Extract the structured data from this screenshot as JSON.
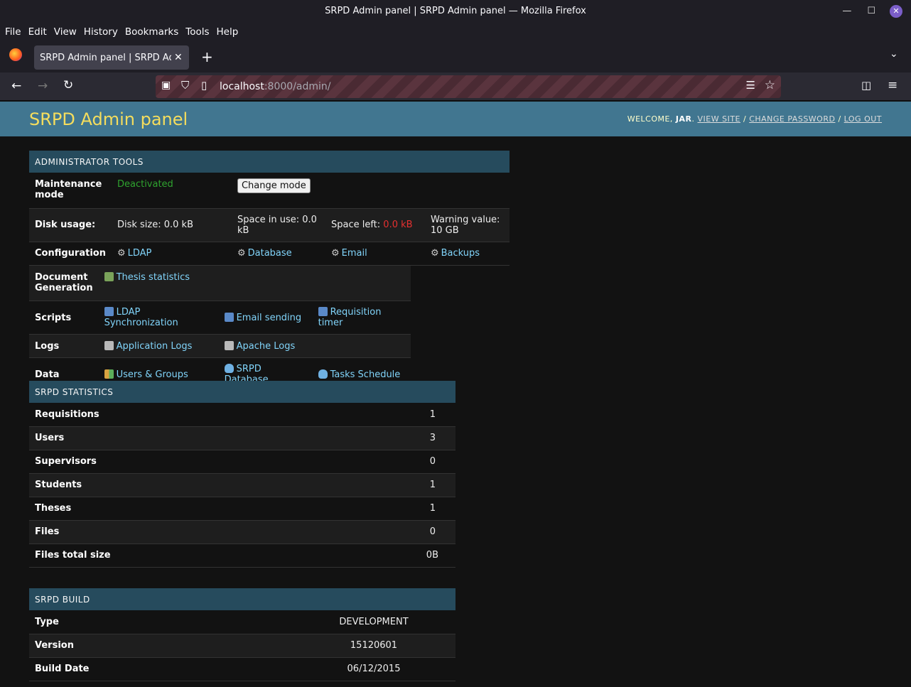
{
  "window": {
    "title": "SRPD Admin panel | SRPD Admin panel — Mozilla Firefox"
  },
  "menu": [
    "File",
    "Edit",
    "View",
    "History",
    "Bookmarks",
    "Tools",
    "Help"
  ],
  "tab": {
    "title": "SRPD Admin panel | SRPD Admi"
  },
  "address": {
    "host": "localhost",
    "rest": ":8000/admin/"
  },
  "header": {
    "brand": "SRPD Admin panel",
    "welcome": "Welcome,",
    "user": "JAR",
    "view_site": "View site",
    "change_password": "Change password",
    "log_out": "Log out"
  },
  "admin_tools": {
    "caption": "Administrator Tools",
    "maintenance_label": "Maintenance mode",
    "maintenance_status": "Deactivated",
    "change_mode": "Change mode",
    "disk_label": "Disk usage:",
    "disk_size": "Disk size: 0.0 kB",
    "space_in_use": "Space in use: 0.0 kB",
    "space_left_label": "Space left:",
    "space_left_value": "0.0 kB",
    "warning_value": "Warning value: 10 GB",
    "config_label": "Configuration",
    "config_ldap": "LDAP",
    "config_database": "Database",
    "config_email": "Email",
    "config_backups": "Backups",
    "docgen_label": "Document Generation",
    "thesis_stats": "Thesis statistics",
    "scripts_label": "Scripts",
    "ldap_sync": "LDAP Synchronization",
    "email_sending": "Email sending",
    "requisition_timer": "Requisition timer",
    "logs_label": "Logs",
    "app_logs": "Application Logs",
    "apache_logs": "Apache Logs",
    "data_label": "Data",
    "users_groups": "Users & Groups",
    "srpd_database": "SRPD Database",
    "tasks_schedule": "Tasks Schedule"
  },
  "statistics": {
    "caption": "SRPD Statistics",
    "rows": [
      {
        "label": "Requisitions",
        "value": "1"
      },
      {
        "label": "Users",
        "value": "3"
      },
      {
        "label": "Supervisors",
        "value": "0"
      },
      {
        "label": "Students",
        "value": "1"
      },
      {
        "label": "Theses",
        "value": "1"
      },
      {
        "label": "Files",
        "value": "0"
      },
      {
        "label": "Files total size",
        "value": "0B"
      }
    ]
  },
  "build": {
    "caption": "SRPD Build",
    "rows": [
      {
        "label": "Type",
        "value": "DEVELOPMENT"
      },
      {
        "label": "Version",
        "value": "15120601"
      },
      {
        "label": "Build Date",
        "value": "06/12/2015"
      }
    ]
  },
  "colors": {
    "header_bg": "#417690",
    "caption_bg": "#264b5d",
    "brand": "#f5dd5d",
    "link": "#81d4fa"
  }
}
